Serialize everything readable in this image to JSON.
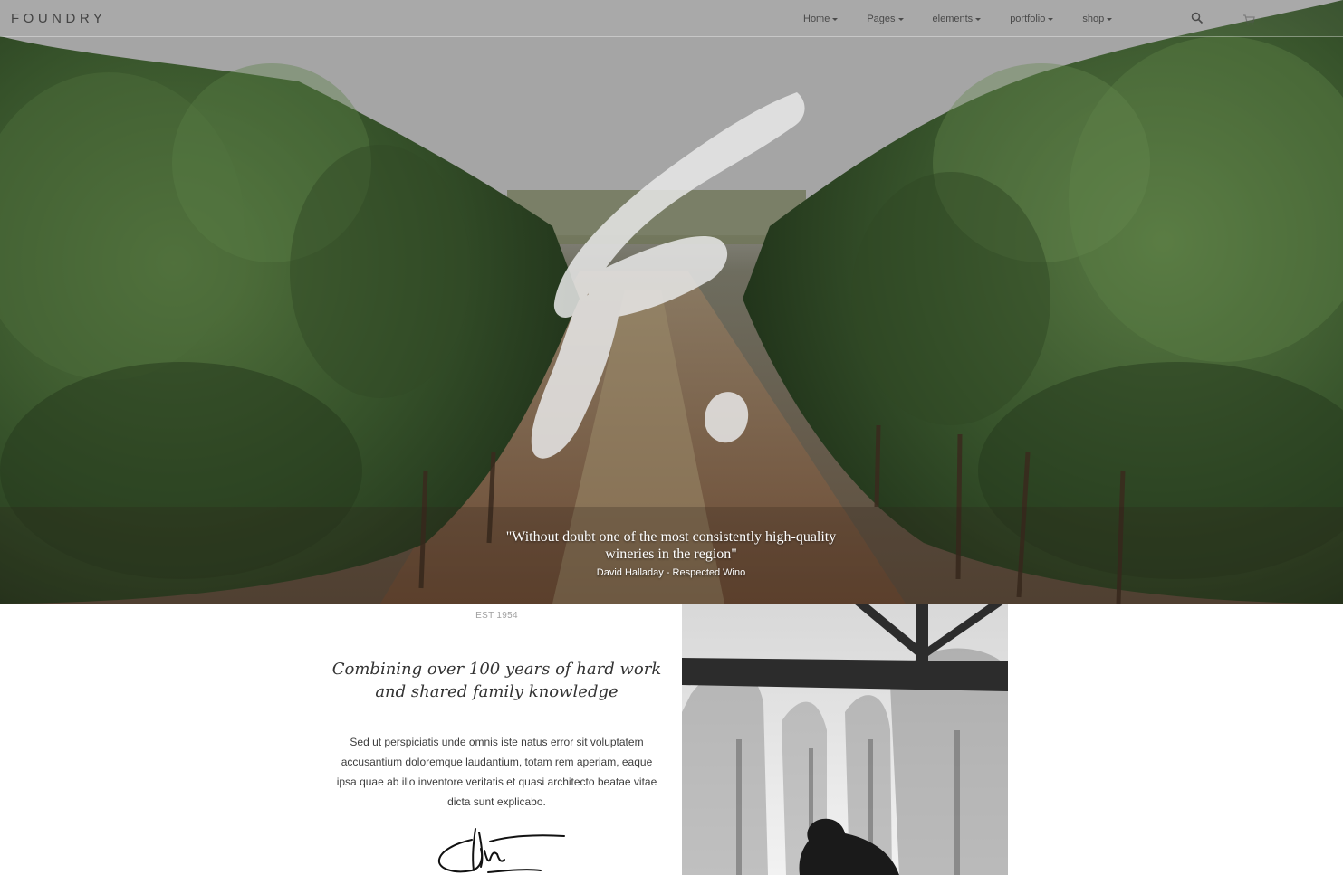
{
  "nav": {
    "logo": "FOUNDRY",
    "items": [
      {
        "label": "Home"
      },
      {
        "label": "Pages"
      },
      {
        "label": "elements"
      },
      {
        "label": "portfolio"
      },
      {
        "label": "shop"
      }
    ],
    "search_icon": "search-icon",
    "cart_icon": "cart-icon"
  },
  "hero": {
    "quote": "\"Without doubt one of the most consistently high-quality wineries in the region\"",
    "author": "David Halladay - Respected Wino"
  },
  "about": {
    "est": "EST 1954",
    "headline": "Combining over 100 years of hard work and shared family knowledge",
    "body": "Sed ut perspiciatis unde omnis iste natus error sit voluptatem accusantium doloremque laudantium, totam rem aperiam, eaque ipsa quae ab illo inventore veritatis et quasi architecto beatae vitae dicta sunt explicabo."
  },
  "colors": {
    "vine_green": "#3f5a30",
    "soil_brown": "#7a5a3d",
    "text_dark": "#333333",
    "text_muted": "#a0a0a0"
  }
}
